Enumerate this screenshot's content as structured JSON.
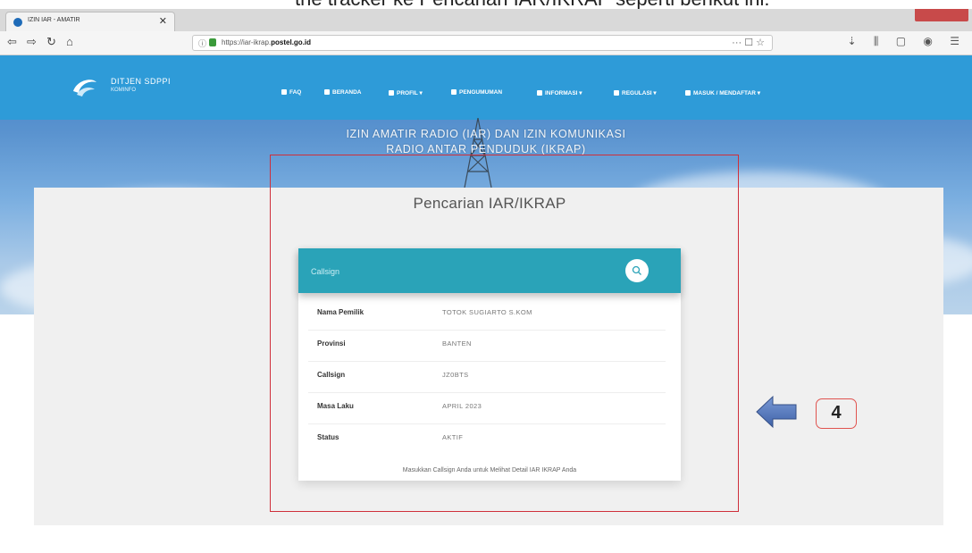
{
  "page_heading": "the tracker ke Pencarian IAR/IKRAP seperti berikut ini:",
  "browser": {
    "tab_title": "IZIN IAR - AMATIR",
    "url_prefix": "https://iar-ikrap.",
    "url_domain": "postel.go.id",
    "url_actions": "··· ☐ ☆",
    "toolbar_icons": "⇣ ⫼ ▢ ◉ ☰"
  },
  "site": {
    "logo_title": "DITJEN SDPPI",
    "logo_subtitle": "KOMINFO",
    "menu": [
      {
        "label": "FAQ",
        "icon": "question-icon"
      },
      {
        "label": "BERANDA",
        "icon": "home-icon"
      },
      {
        "label": "PROFIL ▾",
        "icon": "user-icon"
      },
      {
        "label": "PENGUMUMAN",
        "icon": "megaphone-icon"
      },
      {
        "label": "INFORMASI ▾",
        "icon": "document-icon"
      },
      {
        "label": "REGULASI ▾",
        "icon": "book-icon"
      },
      {
        "label": "MASUK / MENDAFTAR ▾",
        "icon": "login-icon"
      }
    ],
    "hero_title_line1": "IZIN AMATIR RADIO (IAR) DAN IZIN KOMUNIKASI",
    "hero_title_line2": "RADIO ANTAR PENDUDUK (IKRAP)"
  },
  "search": {
    "heading": "Pencarian IAR/IKRAP",
    "placeholder": "Callsign",
    "button_icon": "search-icon"
  },
  "result": [
    {
      "label": "Nama Pemilik",
      "value": "TOTOK SUGIARTO S.KOM"
    },
    {
      "label": "Provinsi",
      "value": "BANTEN"
    },
    {
      "label": "Callsign",
      "value": "JZ0BTS"
    },
    {
      "label": "Masa Laku",
      "value": "APRIL 2023"
    },
    {
      "label": "Status",
      "value": "AKTIF"
    }
  ],
  "notice": "Masukkan Callsign Anda untuk Melihat Detail IAR IKRAP Anda",
  "callout": {
    "number": "4",
    "arrow_color": "#5b7fc0",
    "border_color": "#e0534f"
  },
  "colors": {
    "nav": "#2e9bd8",
    "search_bar": "#2aa3b8",
    "highlight_box": "#cf2f3a"
  }
}
